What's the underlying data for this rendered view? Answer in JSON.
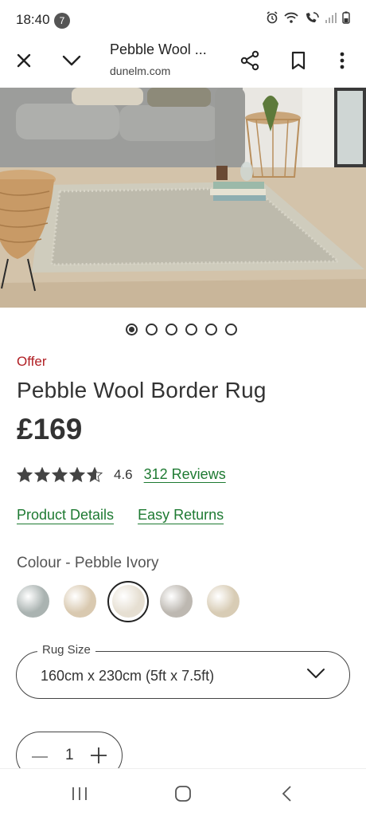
{
  "status_bar": {
    "time": "18:40",
    "notification_count": "7",
    "icons": [
      "alarm-icon",
      "wifi-icon",
      "wifi-calling-icon",
      "signal-icon",
      "battery-icon"
    ]
  },
  "browser": {
    "page_title": "Pebble Wool ...",
    "domain": "dunelm.com",
    "icons": [
      "close-icon",
      "chevron-down-icon",
      "share-icon",
      "bookmark-icon",
      "more-vert-icon"
    ]
  },
  "carousel": {
    "total": 6,
    "active_index": 0
  },
  "product": {
    "offer_label": "Offer",
    "title": "Pebble Wool Border Rug",
    "price": "£169",
    "rating": 4.6,
    "rating_text": "4.6",
    "reviews_link": "312 Reviews",
    "product_details_link": "Product Details",
    "easy_returns_link": "Easy Returns"
  },
  "colour": {
    "label": "Colour - Pebble Ivory",
    "swatches": [
      {
        "name": "swatch-1",
        "color": "#aab3b1",
        "selected": false
      },
      {
        "name": "swatch-2",
        "color": "#d9c9b0",
        "selected": false
      },
      {
        "name": "swatch-3",
        "color": "#e6dfd2",
        "selected": true
      },
      {
        "name": "swatch-4",
        "color": "#bdb8b1",
        "selected": false
      },
      {
        "name": "swatch-5",
        "color": "#d8ccb5",
        "selected": false
      }
    ]
  },
  "size_select": {
    "legend": "Rug Size",
    "value": "160cm x 230cm (5ft x 7.5ft)"
  },
  "quantity": {
    "value": "1"
  },
  "colors": {
    "offer_red": "#b01e23",
    "link_green": "#1e7a32",
    "text": "#333333"
  },
  "nav": {
    "icons": [
      "recents-icon",
      "home-icon",
      "back-icon"
    ]
  }
}
